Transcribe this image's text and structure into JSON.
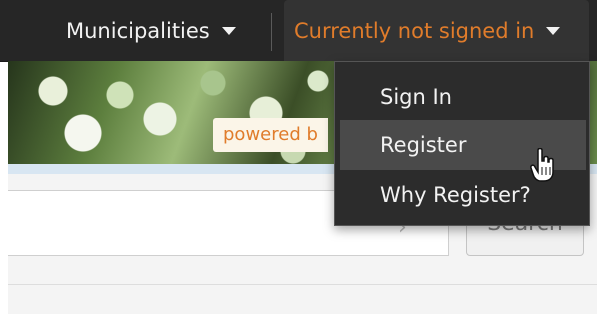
{
  "nav": {
    "municipalities_label": "Municipalities",
    "user_status": "Currently not signed in"
  },
  "hero": {
    "powered_text": "powered b"
  },
  "search": {
    "button_label": "Search"
  },
  "dropdown": {
    "items": [
      {
        "label": "Sign In"
      },
      {
        "label": "Register"
      },
      {
        "label": "Why Register?"
      }
    ]
  },
  "colors": {
    "accent_orange": "#e07c2b",
    "nav_bg": "#262626",
    "menu_bg": "#2c2c2c",
    "menu_hover": "#4a4a4a"
  },
  "icons": [
    "chevron-down-icon",
    "hand-pointer-cursor-icon"
  ]
}
